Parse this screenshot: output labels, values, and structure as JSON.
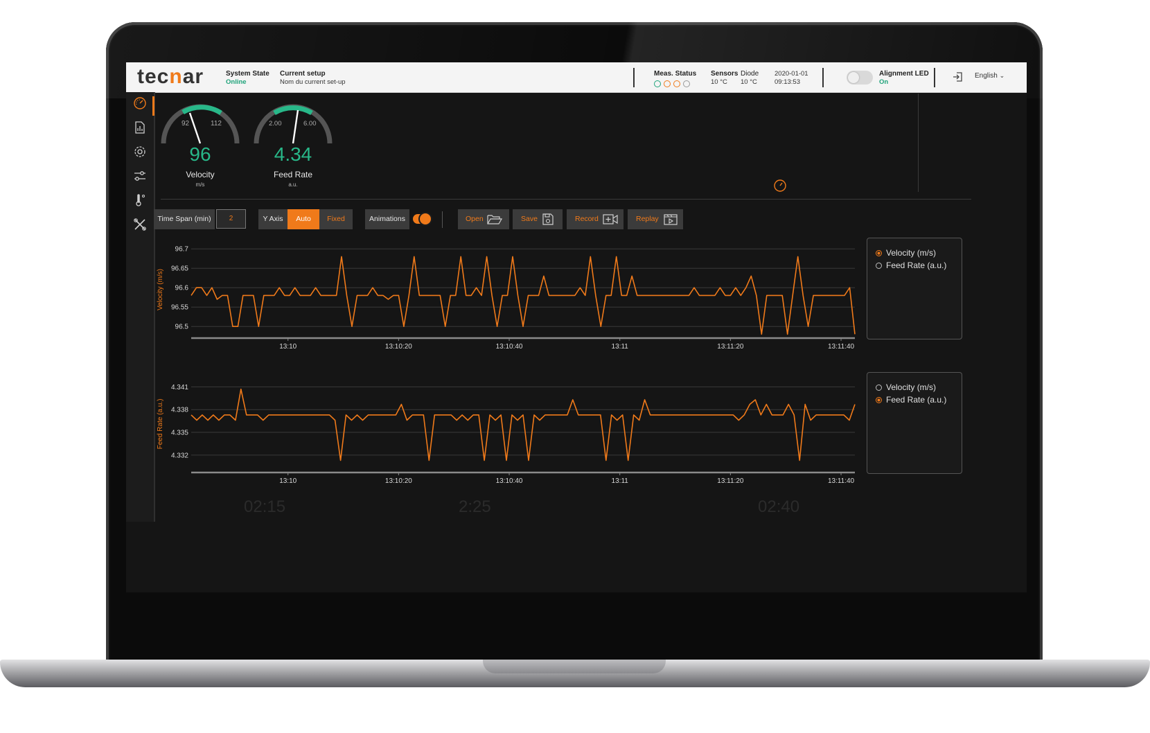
{
  "header": {
    "logo": {
      "prefix": "tec",
      "accent": "n",
      "suffix": "ar"
    },
    "system_state_label": "System State",
    "system_state_value": "Online",
    "current_setup_label": "Current setup",
    "current_setup_value": "Nom du current set-up",
    "meas_status_label": "Meas. Status",
    "meas_status_dots": [
      "#1fa37a",
      "#f07a1a",
      "#f07a1a",
      "#999999"
    ],
    "sensors_label": "Sensors",
    "sensors_value": "10 °C",
    "diode_label": "Diode",
    "diode_value": "10 °C",
    "date": "2020-01-01",
    "time": "09:13:53",
    "alignment_led_label": "Alignment LED",
    "alignment_led_value": "On",
    "language": "English"
  },
  "sidebar": {
    "items": [
      "gauge-icon",
      "report-icon",
      "gear-icon",
      "sliders-icon",
      "thermometer-icon",
      "tools-icon"
    ],
    "active_index": 0
  },
  "gauges": [
    {
      "name": "Velocity",
      "unit": "m/s",
      "value": "96",
      "min_label": "92",
      "max_label": "112",
      "fraction": 0.35
    },
    {
      "name": "Feed Rate",
      "unit": "a.u.",
      "value": "4.34",
      "min_label": "2.00",
      "max_label": "6.00",
      "fraction": 0.58
    }
  ],
  "toolbar": {
    "time_span_label": "Time Span (min)",
    "time_span_value": "2",
    "y_axis_label": "Y Axis",
    "auto_label": "Auto",
    "fixed_label": "Fixed",
    "animations_label": "Animations",
    "animations_on": true,
    "open_label": "Open",
    "save_label": "Save",
    "record_label": "Record",
    "replay_label": "Replay"
  },
  "legend_top": {
    "items": [
      "Velocity (m/s)",
      "Feed Rate (a.u.)"
    ],
    "selected": 0
  },
  "legend_bottom": {
    "items": [
      "Velocity (m/s)",
      "Feed Rate (a.u.)"
    ],
    "selected": 1
  },
  "ghost_times": [
    "02:15",
    "2:25",
    "02:40"
  ],
  "colors": {
    "accent": "#f07a1a",
    "green": "#28b889",
    "background": "#151515"
  },
  "chart_data": [
    {
      "type": "line",
      "ylabel": "Velocity (m/s)",
      "ylim": [
        96.47,
        96.72
      ],
      "yticks": [
        96.7,
        96.65,
        96.6,
        96.55,
        96.5
      ],
      "xtick_labels": [
        "13:10",
        "13:10:20",
        "13:10:40",
        "13:11",
        "13:11:20",
        "13:11:40"
      ],
      "xtick_seconds": [
        17.5,
        37.5,
        57.5,
        77.5,
        97.5,
        117.5
      ],
      "xlim": [
        0,
        120
      ],
      "series": [
        {
          "values": [
            96.58,
            96.6,
            96.6,
            96.58,
            96.6,
            96.57,
            96.58,
            96.58,
            96.5,
            96.5,
            96.58,
            96.58,
            96.58,
            96.5,
            96.58,
            96.58,
            96.58,
            96.6,
            96.58,
            96.58,
            96.6,
            96.58,
            96.58,
            96.58,
            96.6,
            96.58,
            96.58,
            96.58,
            96.58,
            96.68,
            96.58,
            96.5,
            96.58,
            96.58,
            96.58,
            96.6,
            96.58,
            96.58,
            96.57,
            96.58,
            96.58,
            96.5,
            96.58,
            96.68,
            96.58,
            96.58,
            96.58,
            96.58,
            96.58,
            96.5,
            96.58,
            96.58,
            96.68,
            96.58,
            96.58,
            96.6,
            96.58,
            96.68,
            96.58,
            96.5,
            96.58,
            96.58,
            96.68,
            96.58,
            96.5,
            96.58,
            96.58,
            96.58,
            96.63,
            96.58,
            96.58,
            96.58,
            96.58,
            96.58,
            96.58,
            96.6,
            96.58,
            96.68,
            96.58,
            96.5,
            96.58,
            96.58,
            96.68,
            96.58,
            96.58,
            96.63,
            96.58,
            96.58,
            96.58,
            96.58,
            96.58,
            96.58,
            96.58,
            96.58,
            96.58,
            96.58,
            96.58,
            96.6,
            96.58,
            96.58,
            96.58,
            96.58,
            96.6,
            96.58,
            96.58,
            96.6,
            96.58,
            96.6,
            96.63,
            96.58,
            96.48,
            96.58,
            96.58,
            96.58,
            96.58,
            96.48,
            96.58,
            96.68,
            96.58,
            96.5,
            96.58,
            96.58,
            96.58,
            96.58,
            96.58,
            96.58,
            96.58,
            96.6,
            96.48
          ]
        }
      ]
    },
    {
      "type": "line",
      "ylabel": "Feed Rate (a.u.)",
      "ylim": [
        4.3297,
        4.3425
      ],
      "yticks": [
        4.341,
        4.338,
        4.335,
        4.332
      ],
      "xtick_labels": [
        "13:10",
        "13:10:20",
        "13:10:40",
        "13:11",
        "13:11:20",
        "13:11:40"
      ],
      "xtick_seconds": [
        17.5,
        37.5,
        57.5,
        77.5,
        97.5,
        117.5
      ],
      "xlim": [
        0,
        120
      ],
      "series": [
        {
          "values": [
            4.3373,
            4.3366,
            4.3373,
            4.3366,
            4.3373,
            4.3366,
            4.3373,
            4.3373,
            4.3366,
            4.3407,
            4.3373,
            4.3373,
            4.3373,
            4.3366,
            4.3373,
            4.3373,
            4.3373,
            4.3373,
            4.3373,
            4.3373,
            4.3373,
            4.3373,
            4.3373,
            4.3373,
            4.3373,
            4.3373,
            4.3366,
            4.3313,
            4.3373,
            4.3366,
            4.3373,
            4.3366,
            4.3373,
            4.3373,
            4.3373,
            4.3373,
            4.3373,
            4.3373,
            4.3387,
            4.3366,
            4.3373,
            4.3373,
            4.3373,
            4.3313,
            4.3373,
            4.3373,
            4.3373,
            4.3373,
            4.3366,
            4.3373,
            4.3366,
            4.3373,
            4.3373,
            4.3313,
            4.3373,
            4.3366,
            4.3373,
            4.3313,
            4.3373,
            4.3366,
            4.3373,
            4.3313,
            4.3373,
            4.3366,
            4.3373,
            4.3373,
            4.3373,
            4.3373,
            4.3373,
            4.3393,
            4.3373,
            4.3373,
            4.3373,
            4.3373,
            4.3373,
            4.3313,
            4.3373,
            4.3366,
            4.3373,
            4.3313,
            4.3373,
            4.3366,
            4.3393,
            4.3373,
            4.3373,
            4.3373,
            4.3373,
            4.3373,
            4.3373,
            4.3373,
            4.3373,
            4.3373,
            4.3373,
            4.3373,
            4.3373,
            4.3373,
            4.3373,
            4.3373,
            4.3373,
            4.3366,
            4.3373,
            4.3387,
            4.3393,
            4.3373,
            4.3387,
            4.3373,
            4.3373,
            4.3373,
            4.3387,
            4.3373,
            4.3313,
            4.3387,
            4.3366,
            4.3373,
            4.3373,
            4.3373,
            4.3373,
            4.3373,
            4.3373,
            4.3366,
            4.3387
          ]
        }
      ]
    }
  ]
}
